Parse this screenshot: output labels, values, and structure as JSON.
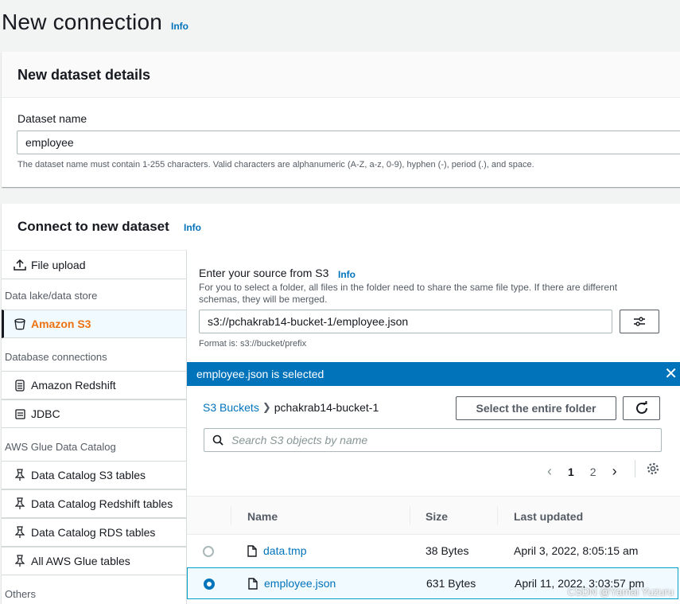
{
  "page": {
    "title": "New connection",
    "info": "Info"
  },
  "dataset_details": {
    "title": "New dataset details",
    "name_label": "Dataset name",
    "name_value": "employee",
    "hint": "The dataset name must contain 1-255 characters. Valid characters are alphanumeric (A-Z, a-z, 0-9), hyphen (-), period (.), and space."
  },
  "connect": {
    "title": "Connect to new dataset",
    "info": "Info",
    "nav": {
      "file_upload": "File upload",
      "group_datalake": "Data lake/data store",
      "amazon_s3": "Amazon S3",
      "group_db": "Database connections",
      "redshift": "Amazon Redshift",
      "jdbc": "JDBC",
      "group_glue": "AWS Glue Data Catalog",
      "dc_s3": "Data Catalog S3 tables",
      "dc_redshift": "Data Catalog Redshift tables",
      "dc_rds": "Data Catalog RDS tables",
      "all_glue": "All AWS Glue tables",
      "group_others": "Others"
    },
    "source": {
      "label": "Enter your source from S3",
      "info": "Info",
      "description": "For you to select a folder, all files in the folder need to share the same file type. If there are different schemas, they will be merged.",
      "value": "s3://pchakrab14-bucket-1/employee.json",
      "format": "Format is: s3://bucket/prefix"
    },
    "selection_banner": "employee.json is selected",
    "breadcrumb": {
      "root": "S3 Buckets",
      "current": "pchakrab14-bucket-1"
    },
    "select_folder_button": "Select the entire folder",
    "search_placeholder": "Search S3 objects by name",
    "pagination": {
      "current": "1",
      "next": "2"
    },
    "table": {
      "headers": {
        "name": "Name",
        "size": "Size",
        "updated": "Last updated"
      },
      "rows": [
        {
          "name": "data.tmp",
          "size": "38 Bytes",
          "updated": "April 3, 2022, 8:05:15 am",
          "selected": false
        },
        {
          "name": "employee.json",
          "size": "631 Bytes",
          "updated": "April 11, 2022, 3:03:57 pm",
          "selected": true
        }
      ]
    }
  },
  "watermark": "CSDN @Yamai Yuzuru",
  "colors": {
    "accent": "#0073bb",
    "selected_nav": "#ec7211",
    "banner": "#0073bb"
  }
}
